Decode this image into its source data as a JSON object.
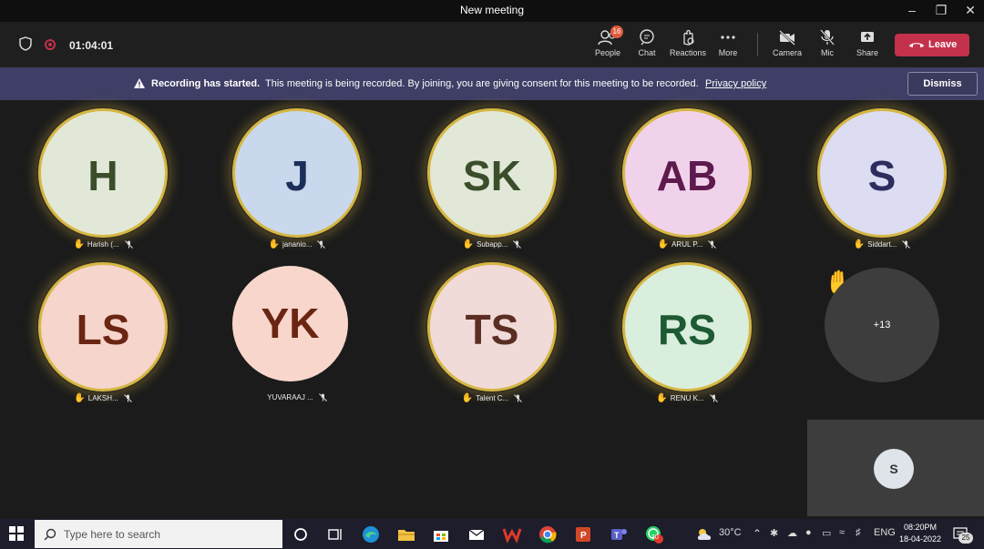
{
  "window": {
    "title": "New meeting"
  },
  "toolbar": {
    "timer": "01:04:01",
    "people": {
      "label": "People",
      "badge": "16"
    },
    "chat_label": "Chat",
    "reactions_label": "Reactions",
    "more_label": "More",
    "camera_label": "Camera",
    "mic_label": "Mic",
    "share_label": "Share",
    "leave_label": "Leave"
  },
  "banner": {
    "title": "Recording has started.",
    "message": "This meeting is being recorded. By joining, you are giving consent for this meeting to be recorded.",
    "link": "Privacy policy",
    "dismiss_label": "Dismiss"
  },
  "participants": [
    {
      "initials": "H",
      "name": "Harish (...",
      "hand_raised": true,
      "bg": "#e2e8d7",
      "fg": "#3a4e2b"
    },
    {
      "initials": "J",
      "name": "jananio...",
      "hand_raised": true,
      "bg": "#c9d8ec",
      "fg": "#1c2e5a"
    },
    {
      "initials": "SK",
      "name": "Subapp...",
      "hand_raised": true,
      "bg": "#e2e8d7",
      "fg": "#3a4e2b"
    },
    {
      "initials": "AB",
      "name": "ARUL P...",
      "hand_raised": true,
      "bg": "#f0d3ea",
      "fg": "#5e1a4e"
    },
    {
      "initials": "S",
      "name": "Siddart...",
      "hand_raised": true,
      "bg": "#dcdcf2",
      "fg": "#2e2b5e"
    },
    {
      "initials": "LS",
      "name": "LAKSH...",
      "hand_raised": true,
      "bg": "#f5d5cc",
      "fg": "#6a2612"
    },
    {
      "initials": "YK",
      "name": "YUVARAAJ ...",
      "hand_raised": false,
      "bg": "#f8d6cb",
      "fg": "#6a2612"
    },
    {
      "initials": "TS",
      "name": "Talent C...",
      "hand_raised": true,
      "bg": "#f0dbd9",
      "fg": "#5a2e22"
    },
    {
      "initials": "RS",
      "name": "RENU K...",
      "hand_raised": true,
      "bg": "#d9eedc",
      "fg": "#1e5a34"
    }
  ],
  "overflow": {
    "label": "+13"
  },
  "self_view": {
    "initials": "S"
  },
  "taskbar": {
    "search_placeholder": "Type here to search",
    "weather": "30°C",
    "language": "ENG",
    "time": "08:20PM",
    "date": "18-04-2022",
    "notifications": "25",
    "whatsapp_badge": "30"
  },
  "colors": {
    "leave": "#c4314b",
    "banner": "#3e3e66",
    "ring": "#d6b744"
  }
}
